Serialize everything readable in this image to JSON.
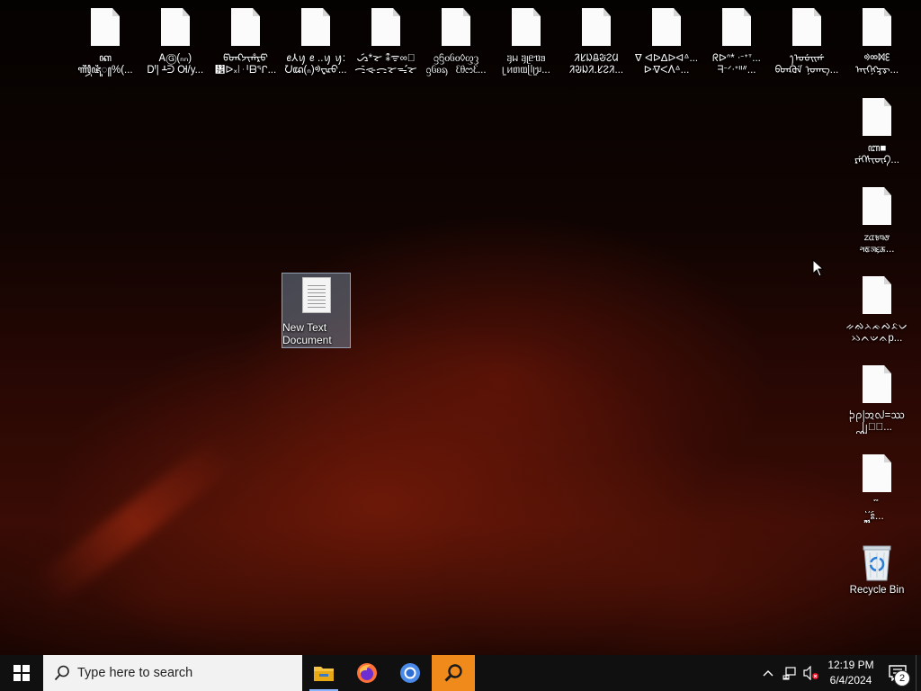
{
  "desktop": {
    "top_row_icons": [
      {
        "line1": "ꦏ",
        "line2": "ꦬ꧀ꦮꦷꦗꦶꦸ꧀%(..."
      },
      {
        "line1": "ᎪⒼ(ₙₙ)",
        "line2": "ᎠꞋ| ᚆᕭ Ꮊ/y..."
      },
      {
        "line1": "ᡦᡨᡭᠵᡳᡥᡵᡦ",
        "line2": "᥵ᐅ᙮⦚ᆡᗷᕐᒋ..."
      },
      {
        "line1": "ꫀ⅄ꪗ ꫀ ..ꪗ ꪗ:",
        "line2": "ᘢꦢ(ₙ)ᢀᢏᡅᡉ..."
      },
      {
        "line1": "ᯁᯯ*ᯘ ⁑ᯤ∞ᯩ",
        "line2": "ᯏᯰᯐᯌᯘᯓᯨᯘ"
      },
      {
        "line1": "ᦋᦌᦞᦑᦞ◊ᦐᦡ",
        "line2": "ᦋᦑᦈᦣ⁀ᦷᦲᦂᦷ..."
      },
      {
        "line1": "ᥠᥕ ᥠᥨᥱᥓᥑ",
        "line2": "ᥧ ᥢᥖᥗᥫᥧᥭ..."
      },
      {
        "line1": "ᱤᱥᱡᱪᱶᱮᱢ",
        "line2": "ᱤᱶᱡᱤᱹᱥᱮᱤ..."
      },
      {
        "line1": "ᐁ ᐊᐅᐃᐆᐋᐞ...",
        "line2": "ᐅᐌᐹᐰᐞ..."
      },
      {
        "line1": "ᖇᐅᐢ* ᐧᐨᐩᐪ...",
        "line2": "ᖷᐨᐟᐧᐩᐦᐥ..."
      },
      {
        "line1": "ꫂᠤᡠᡳᡤ",
        "line2": "ᡋᡨᡘᡆᡝ ᠨᡨᡊ..."
      },
      {
        "line1": "ᢀᢁᢂᢄᢅᢆ",
        "line2": "ᢇᢈᢉᢊᢋᢌ..."
      }
    ],
    "right_column_icons": [
      {
        "line1": "ꦧ■",
        "line2": "ᠷᡝᢉᠰᡕᡡᡗ..."
      },
      {
        "line1": "ᤁᤂᤃᤄᤅ",
        "line2": "ᤆᤇᤈᤉᤊ..."
      },
      {
        "line1": "ᨀᨁᨂᨃᨄᨅᨆ",
        "line2": "ᨇᨈᨉᨊp..."
      },
      {
        "line1": "ᩐᩑᩒᩓ=ᩔ",
        "line2": "ᩕᩖᩗ⊥ᩘ..."
      },
      {
        "line1": "ᩙ",
        "line2": "ᩚᩛᩜᩝᩞᩡᩢ..."
      }
    ],
    "selected_icon": {
      "line1": "New Text",
      "line2": "Document"
    },
    "recycle_bin": {
      "label": "Recycle Bin"
    }
  },
  "taskbar": {
    "search_placeholder": "Type here to search",
    "pinned_apps": [
      {
        "name": "file-explorer",
        "state": "running"
      },
      {
        "name": "firefox",
        "state": "pinned"
      },
      {
        "name": "chromium",
        "state": "pinned"
      },
      {
        "name": "search-app",
        "state": "active"
      }
    ],
    "clock": {
      "time": "12:19 PM",
      "date": "6/4/2024"
    },
    "notification_count": "2"
  },
  "colors": {
    "taskbar_bg": "#101010",
    "active_app": "#f08a1a",
    "selection": "#6e8296"
  }
}
